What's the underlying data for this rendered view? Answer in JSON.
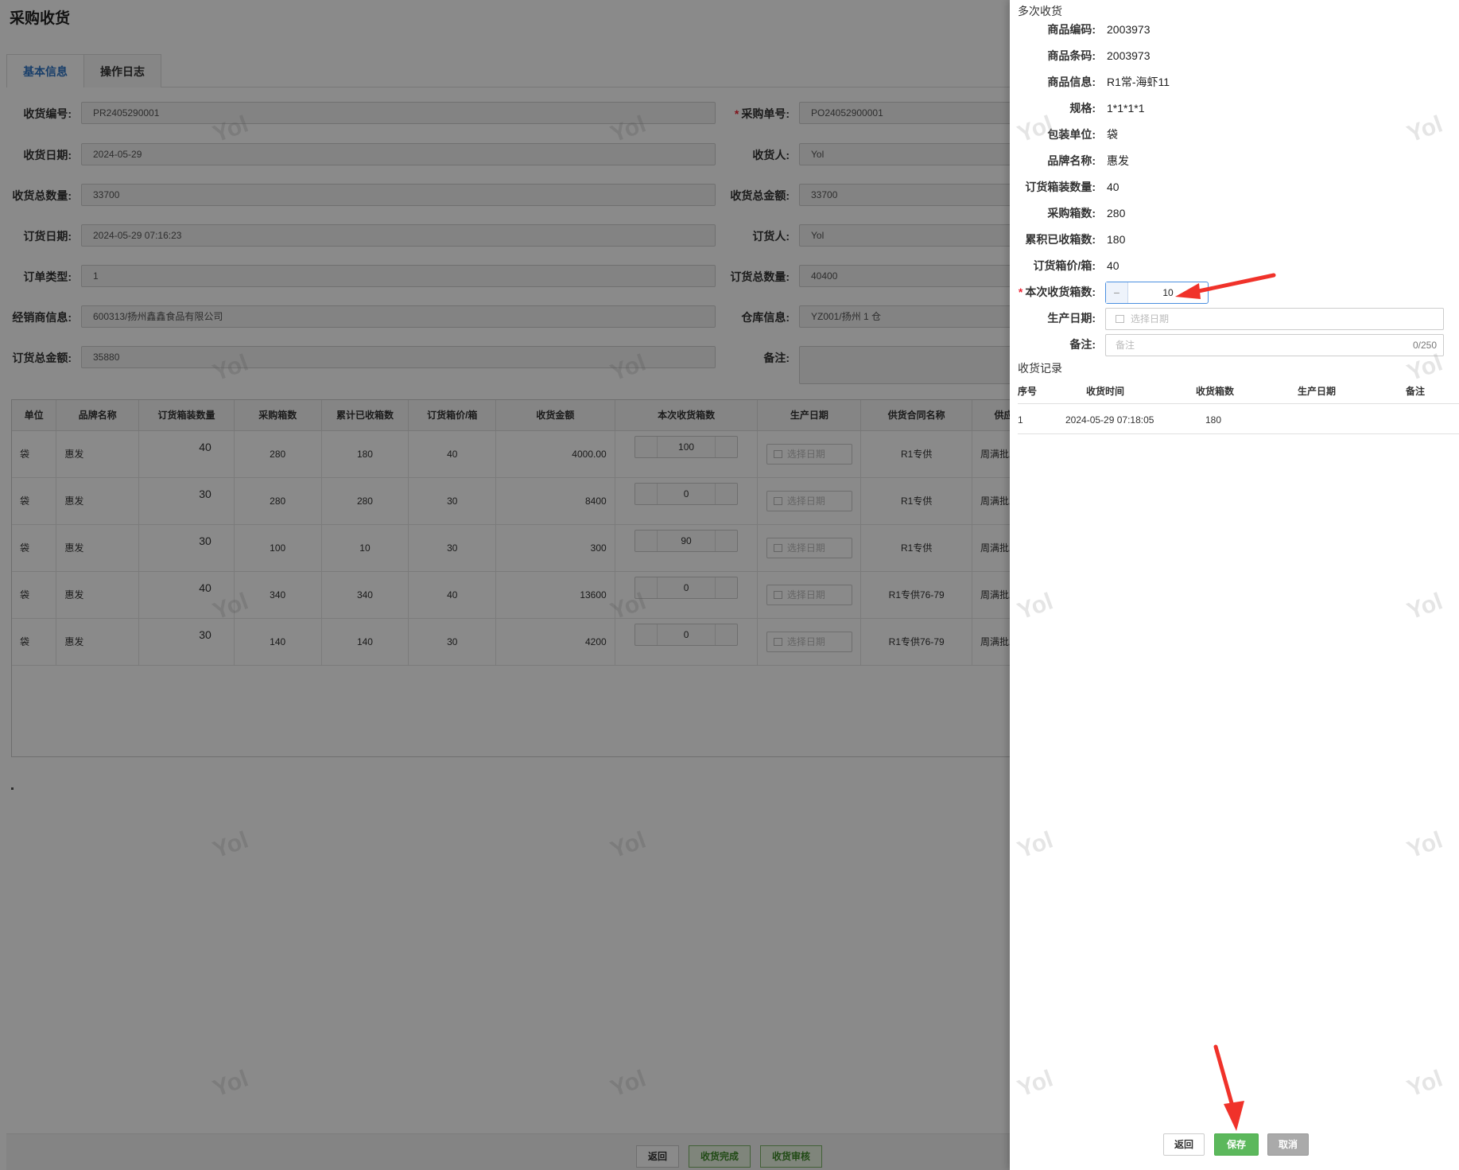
{
  "page": {
    "title": "采购收货",
    "tabs": [
      {
        "label": "基本信息",
        "active": true
      },
      {
        "label": "操作日志",
        "active": false
      }
    ],
    "form": {
      "receipt_no_label": "收货编号:",
      "receipt_no": "PR2405290001",
      "po_no_label": "采购单号:",
      "po_no": "PO24052900001",
      "receipt_date_label": "收货日期:",
      "receipt_date": "2024-05-29",
      "receiver_label": "收货人:",
      "receiver": "Yol",
      "total_qty_label": "收货总数量:",
      "total_qty": "33700",
      "total_amount_label": "收货总金额:",
      "total_amount": "33700",
      "order_date_label": "订货日期:",
      "order_date": "2024-05-29 07:16:23",
      "orderer_label": "订货人:",
      "orderer": "Yol",
      "order_type_label": "订单类型:",
      "order_type": "1",
      "order_qty_label": "订货总数量:",
      "order_qty": "40400",
      "dealer_label": "经销商信息:",
      "dealer": "600313/扬州鑫鑫食品有限公司",
      "warehouse_label": "仓库信息:",
      "warehouse": "YZ001/扬州 1 仓",
      "order_amount_label": "订货总金额:",
      "order_amount": "35880",
      "remark_label": "备注:"
    },
    "grid": {
      "headers": [
        "单位",
        "品牌名称",
        "订货箱装数量",
        "采购箱数",
        "累计已收箱数",
        "订货箱价/箱",
        "收货金额",
        "本次收货箱数",
        "生产日期",
        "供货合同名称",
        "供应"
      ],
      "date_placeholder": "选择日期",
      "rows": [
        {
          "unit": "袋",
          "brand": "惠发",
          "pack_qty": "40",
          "purchase_boxes": "280",
          "received_boxes": "180",
          "price": "40",
          "amount": "4000.00",
          "this_receipt": "100",
          "contract": "R1专供",
          "supplier": "周满批发"
        },
        {
          "unit": "袋",
          "brand": "惠发",
          "pack_qty": "30",
          "purchase_boxes": "280",
          "received_boxes": "280",
          "price": "30",
          "amount": "8400",
          "this_receipt": "0",
          "contract": "R1专供",
          "supplier": "周满批发"
        },
        {
          "unit": "袋",
          "brand": "惠发",
          "pack_qty": "30",
          "purchase_boxes": "100",
          "received_boxes": "10",
          "price": "30",
          "amount": "300",
          "this_receipt": "90",
          "contract": "R1专供",
          "supplier": "周满批发"
        },
        {
          "unit": "袋",
          "brand": "惠发",
          "pack_qty": "40",
          "purchase_boxes": "340",
          "received_boxes": "340",
          "price": "40",
          "amount": "13600",
          "this_receipt": "0",
          "contract": "R1专供76-79",
          "supplier": "周满批发"
        },
        {
          "unit": "袋",
          "brand": "惠发",
          "pack_qty": "30",
          "purchase_boxes": "140",
          "received_boxes": "140",
          "price": "30",
          "amount": "4200",
          "this_receipt": "0",
          "contract": "R1专供76-79",
          "supplier": "周满批发"
        }
      ]
    },
    "footer": {
      "back": "返回",
      "complete": "收货完成",
      "audit": "收货审核"
    },
    "watermark": "Yol"
  },
  "drawer": {
    "title": "多次收货",
    "fields": [
      {
        "label": "商品编码:",
        "value": "2003973"
      },
      {
        "label": "商品条码:",
        "value": "2003973"
      },
      {
        "label": "商品信息:",
        "value": "R1常-海虾11"
      },
      {
        "label": "规格:",
        "value": "1*1*1*1"
      },
      {
        "label": "包装单位:",
        "value": "袋"
      },
      {
        "label": "品牌名称:",
        "value": "惠发"
      },
      {
        "label": "订货箱装数量:",
        "value": "40"
      },
      {
        "label": "采购箱数:",
        "value": "280"
      },
      {
        "label": "累积已收箱数:",
        "value": "180"
      },
      {
        "label": "订货箱价/箱:",
        "value": "40"
      }
    ],
    "this_receipt_label": "本次收货箱数:",
    "this_receipt_value": "10",
    "minus_symbol": "−",
    "production_date_label": "生产日期:",
    "production_date_placeholder": "选择日期",
    "remark_label": "备注:",
    "remark_placeholder": "备注",
    "remark_counter": "0/250",
    "records_title": "收货记录",
    "records_headers": [
      "序号",
      "收货时间",
      "收货箱数",
      "生产日期",
      "备注"
    ],
    "records": [
      {
        "no": "1",
        "time": "2024-05-29 07:18:05",
        "boxes": "180",
        "date": "",
        "remark": ""
      }
    ],
    "buttons": {
      "back": "返回",
      "save": "保存",
      "cancel": "取消"
    }
  },
  "colors": {
    "accent": "#2d74c4",
    "save": "#5cb85c",
    "arrow": "#f0322a"
  }
}
